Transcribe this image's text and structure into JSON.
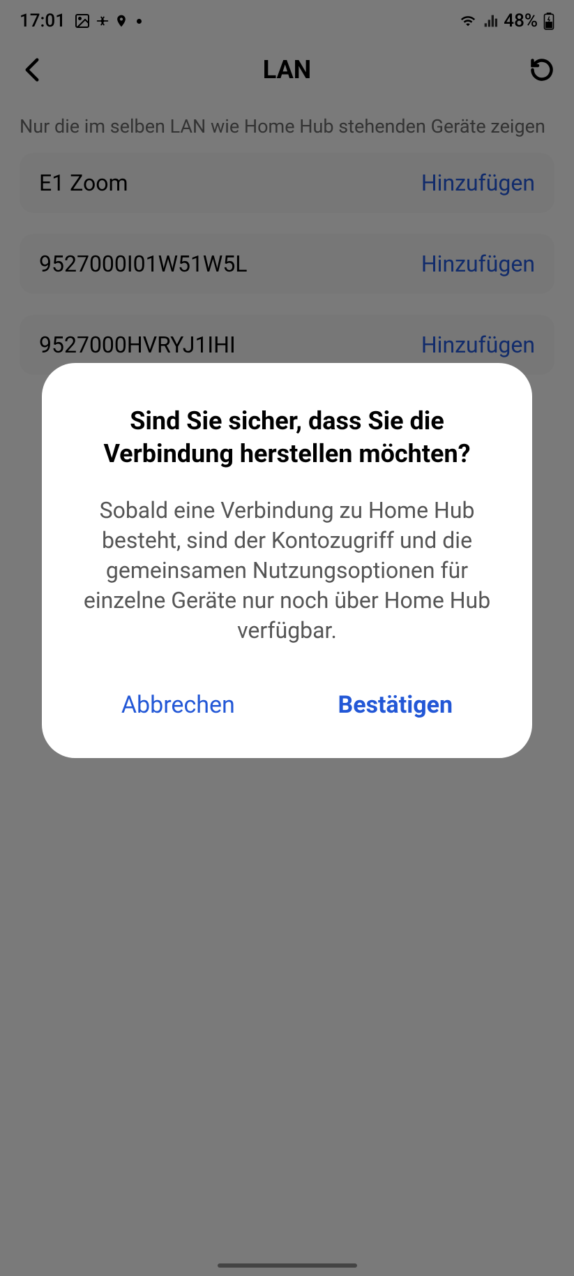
{
  "status_bar": {
    "time": "17:01",
    "battery": "48%"
  },
  "header": {
    "title": "LAN"
  },
  "description": "Nur die im selben LAN wie Home Hub stehenden Geräte zeigen",
  "devices": [
    {
      "name": "E1 Zoom",
      "action": "Hinzufügen"
    },
    {
      "name": "9527000I01W51W5L",
      "action": "Hinzufügen"
    },
    {
      "name": "9527000HVRYJ1IHI",
      "action": "Hinzufügen"
    }
  ],
  "dialog": {
    "title": "Sind Sie sicher, dass Sie die Verbindung herstellen möchten?",
    "body": "Sobald eine Verbindung zu Home Hub besteht, sind der Kontozugriff und die gemeinsamen Nutzungsoptionen für einzelne Geräte nur noch über Home Hub verfügbar.",
    "cancel": "Abbrechen",
    "confirm": "Bestätigen"
  }
}
